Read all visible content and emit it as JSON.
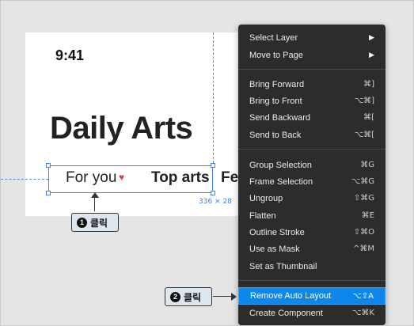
{
  "canvas": {
    "time": "9:41",
    "title": "Daily Arts",
    "tabs": [
      "For you",
      "Top arts",
      "Fe"
    ],
    "heart_icon": "heart-icon",
    "selection_size": "336 × 28"
  },
  "callouts": {
    "step1": {
      "number": "1",
      "label": "클릭"
    },
    "step2": {
      "number": "2",
      "label": "클릭"
    }
  },
  "menu": {
    "items": [
      {
        "label": "Select Layer",
        "shortcut": "",
        "submenu": "▶"
      },
      {
        "label": "Move to Page",
        "shortcut": "",
        "submenu": "▶"
      },
      {
        "label": "Bring Forward",
        "shortcut": "⌘]"
      },
      {
        "label": "Bring to Front",
        "shortcut": "⌥⌘]"
      },
      {
        "label": "Send Backward",
        "shortcut": "⌘["
      },
      {
        "label": "Send to Back",
        "shortcut": "⌥⌘["
      },
      {
        "label": "Group Selection",
        "shortcut": "⌘G"
      },
      {
        "label": "Frame Selection",
        "shortcut": "⌥⌘G"
      },
      {
        "label": "Ungroup",
        "shortcut": "⇧⌘G"
      },
      {
        "label": "Flatten",
        "shortcut": "⌘E"
      },
      {
        "label": "Outline Stroke",
        "shortcut": "⇧⌘O"
      },
      {
        "label": "Use as Mask",
        "shortcut": "^⌘M"
      },
      {
        "label": "Set as Thumbnail",
        "shortcut": ""
      },
      {
        "label": "Remove Auto Layout",
        "shortcut": "⌥⇧A"
      },
      {
        "label": "Create Component",
        "shortcut": "⌥⌘K"
      }
    ],
    "highlight_color": "#0d87ea"
  }
}
